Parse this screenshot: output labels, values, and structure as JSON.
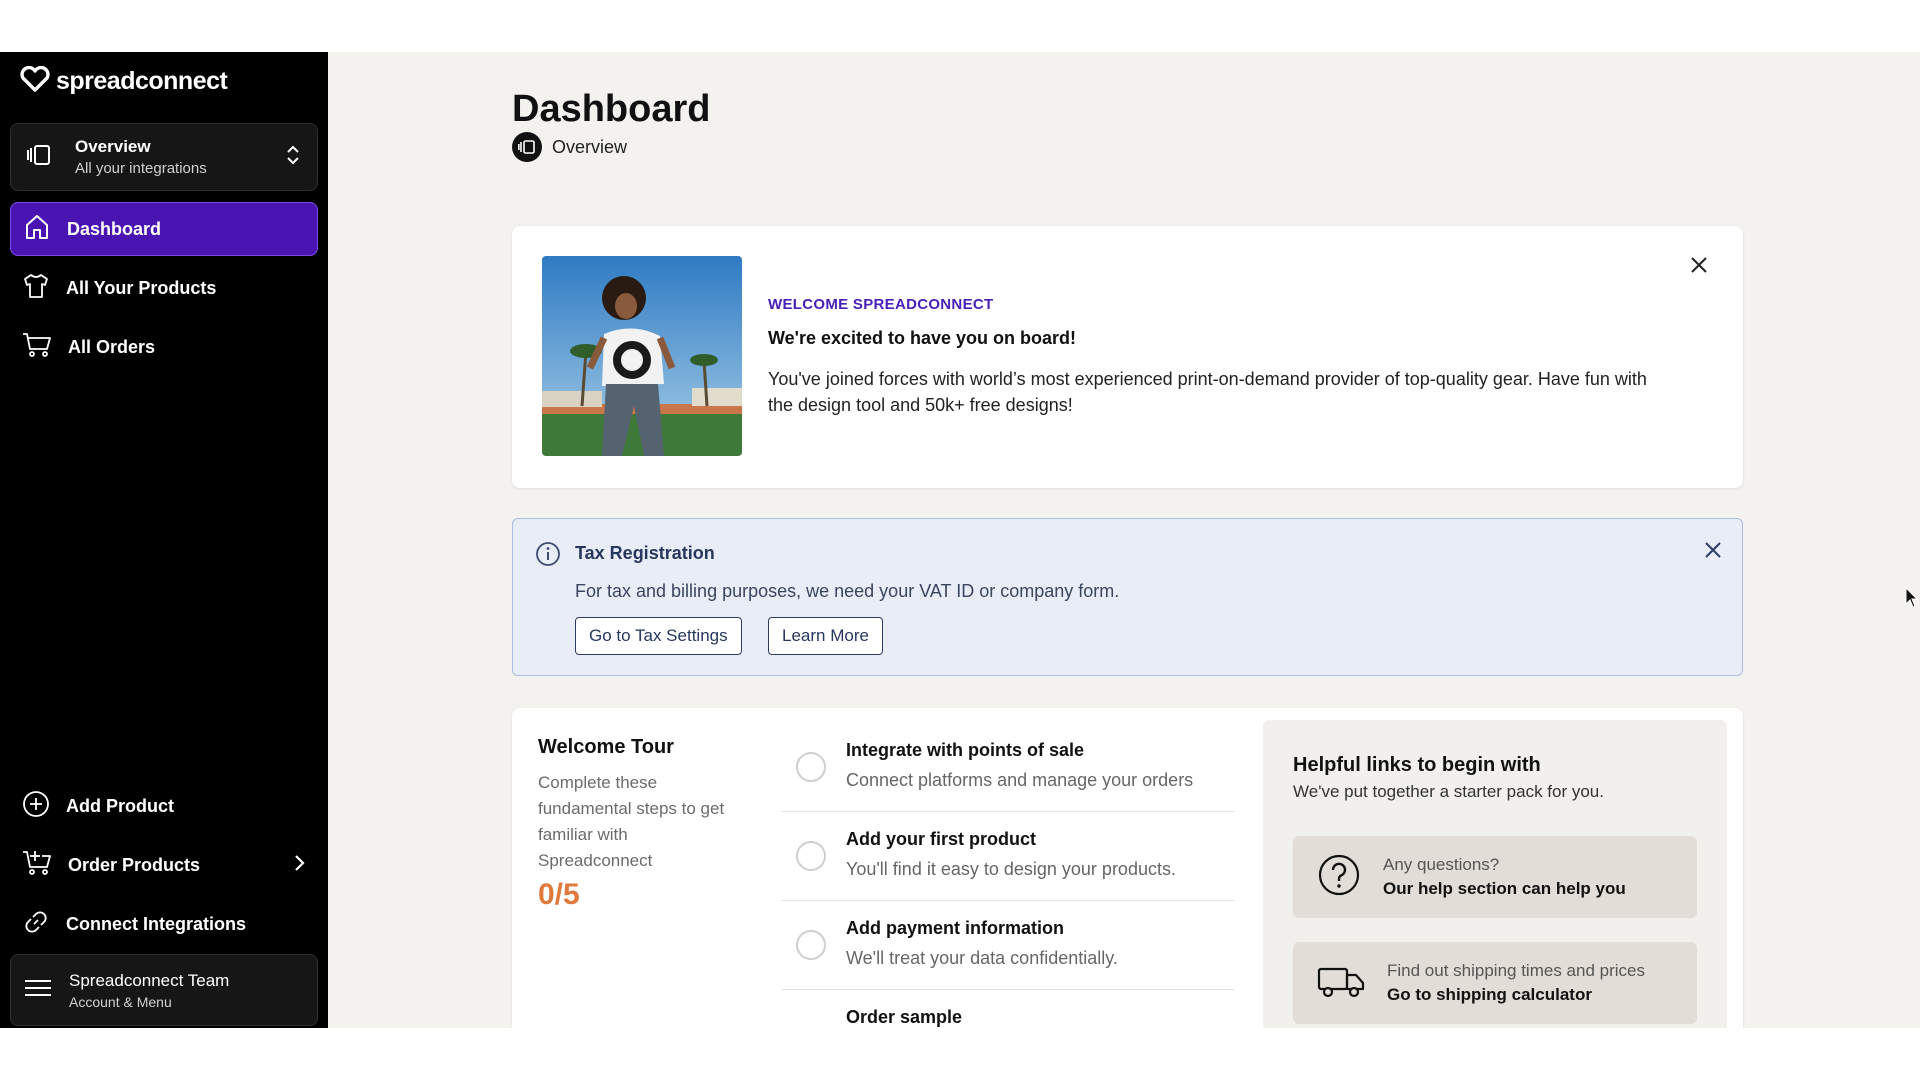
{
  "brand": {
    "name": "spreadconnect"
  },
  "switcher": {
    "title": "Overview",
    "subtitle": "All your integrations"
  },
  "nav": {
    "dashboard": "Dashboard",
    "products": "All Your Products",
    "orders": "All Orders",
    "add_product": "Add Product",
    "order_products": "Order Products",
    "connect_integrations": "Connect Integrations"
  },
  "account": {
    "title": "Spreadconnect Team",
    "subtitle": "Account & Menu"
  },
  "header": {
    "title": "Dashboard",
    "breadcrumb": "Overview"
  },
  "welcome": {
    "eyebrow": "WELCOME SPREADCONNECT",
    "title": "We're excited to have you on board!",
    "body": "You've joined forces with world’s most experienced print-on-demand provider of top-quality gear. Have fun with the design tool and 50k+ free designs!"
  },
  "tax": {
    "title": "Tax Registration",
    "body": "For tax and billing purposes, we need your VAT ID or company form.",
    "primary_button": "Go to Tax Settings",
    "secondary_button": "Learn More"
  },
  "tour": {
    "title": "Welcome Tour",
    "description": "Complete these fundamental steps to get familiar with Spreadconnect",
    "progress": "0/5",
    "steps": [
      {
        "title": "Integrate with points of sale",
        "subtitle": "Connect platforms and manage your orders"
      },
      {
        "title": "Add your first product",
        "subtitle": "You'll find it easy to design your products."
      },
      {
        "title": "Add payment information",
        "subtitle": "We'll treat your data confidentially."
      },
      {
        "title": "Order sample",
        "subtitle": ""
      }
    ]
  },
  "help": {
    "title": "Helpful links to begin with",
    "subtitle": "We've put together a starter pack for you.",
    "links": [
      {
        "top": "Any questions?",
        "bottom": "Our help section can help you",
        "icon": "question-circle-icon"
      },
      {
        "top": "Find out shipping times and prices",
        "bottom": "Go to shipping calculator",
        "icon": "truck-icon"
      }
    ]
  },
  "colors": {
    "sidebar_bg": "#000000",
    "active_nav": "#4a14b3",
    "eyebrow": "#4a20b8",
    "tax_bg": "#e9edf8",
    "tour_count": "#e07a3c",
    "main_bg": "#f4f2ee"
  }
}
